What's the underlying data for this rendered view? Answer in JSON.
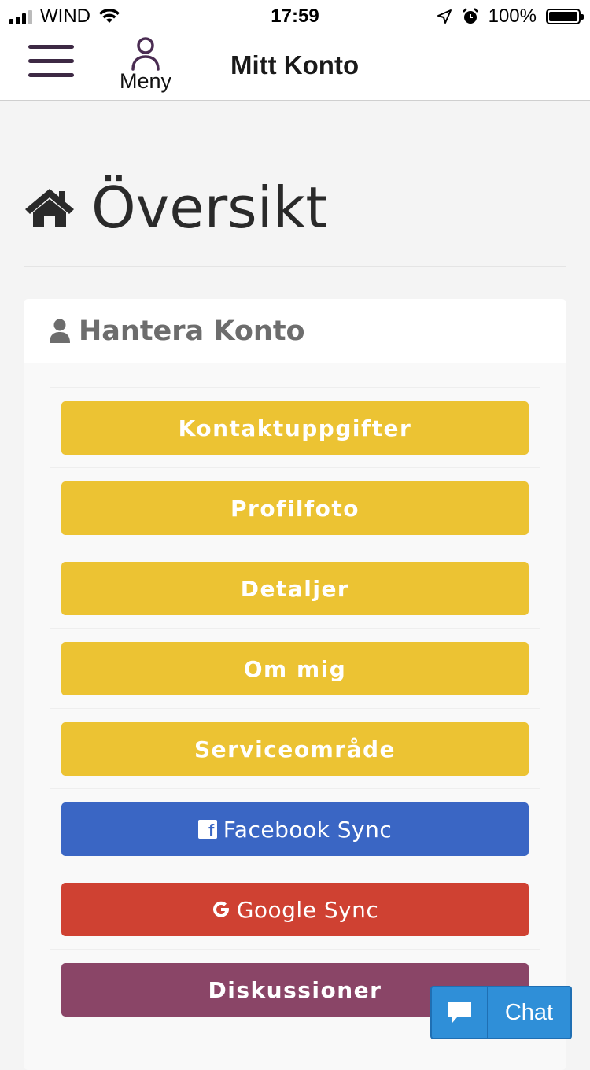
{
  "status_bar": {
    "carrier": "WIND",
    "time": "17:59",
    "battery": "100%"
  },
  "navbar": {
    "menu_label": "Meny",
    "title": "Mitt Konto"
  },
  "page": {
    "title": "Översikt"
  },
  "panel": {
    "title": "Hantera Konto",
    "buttons": [
      {
        "label": "Kontaktuppgifter",
        "color": "#ecc333"
      },
      {
        "label": "Profilfoto",
        "color": "#ecc333"
      },
      {
        "label": "Detaljer",
        "color": "#ecc333"
      },
      {
        "label": "Om mig",
        "color": "#ecc333"
      },
      {
        "label": "Serviceområde",
        "color": "#ecc333"
      },
      {
        "label": "Facebook Sync",
        "color": "#3a66c4",
        "icon": "facebook-icon"
      },
      {
        "label": "Google Sync",
        "color": "#cf4132",
        "icon": "google-icon"
      },
      {
        "label": "Diskussioner",
        "color": "#8a4567"
      }
    ]
  },
  "chat": {
    "label": "Chat",
    "icon": "chat-bubble-icon",
    "color": "#2f8fd8"
  }
}
